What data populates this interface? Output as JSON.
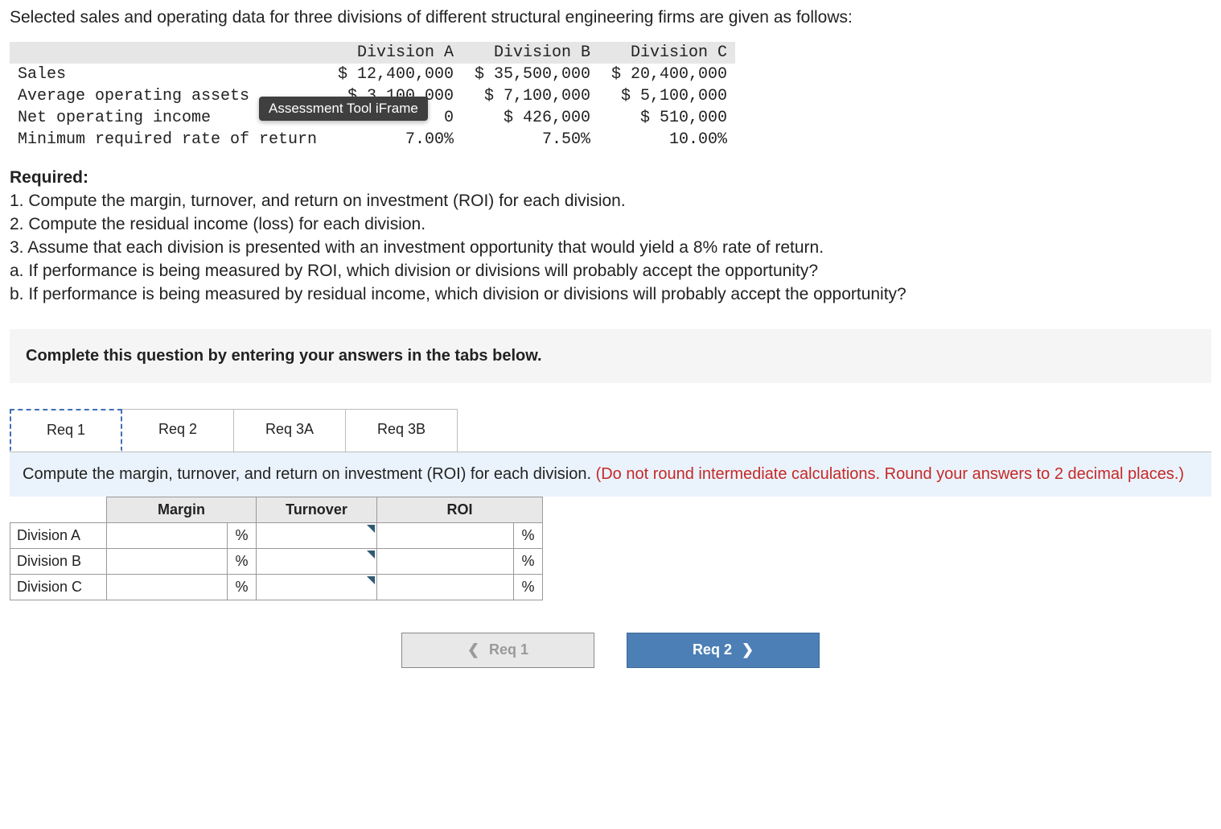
{
  "intro": "Selected sales and operating data for three divisions of different structural engineering firms are given as follows:",
  "data_table": {
    "col_headers": [
      "Division A",
      "Division B",
      "Division C"
    ],
    "rows": [
      {
        "label": "Sales",
        "vals": [
          "$ 12,400,000",
          "$ 35,500,000",
          "$ 20,400,000"
        ]
      },
      {
        "label": "Average operating assets",
        "vals": [
          "$ 3,100,000",
          "$ 7,100,000",
          "$ 5,100,000"
        ]
      },
      {
        "label": "Net operating income",
        "vals": [
          "0",
          "$ 426,000",
          "$ 510,000"
        ]
      },
      {
        "label": "Minimum required rate of return",
        "vals": [
          "7.00%",
          "7.50%",
          "10.00%"
        ]
      }
    ],
    "tooltip": "Assessment Tool iFrame"
  },
  "required": {
    "header": "Required:",
    "lines": [
      "1. Compute the margin, turnover, and return on investment (ROI) for each division.",
      "2. Compute the residual income (loss) for each division.",
      "3. Assume that each division is presented with an investment opportunity that would yield a 8% rate of return.",
      "a. If performance is being measured by ROI, which division or divisions will probably accept the opportunity?",
      "b. If performance is being measured by residual income, which division or divisions will probably accept the opportunity?"
    ]
  },
  "instruction_band": "Complete this question by entering your answers in the tabs below.",
  "tabs": [
    {
      "label": "Req 1",
      "active": true
    },
    {
      "label": "Req 2",
      "active": false
    },
    {
      "label": "Req 3A",
      "active": false
    },
    {
      "label": "Req 3B",
      "active": false
    }
  ],
  "tab_instruction": {
    "main": "Compute the margin, turnover, and return on investment (ROI) for each division. ",
    "hint": "(Do not round intermediate calculations. Round your answers to 2 decimal places.)"
  },
  "answer_table": {
    "headers": [
      "Margin",
      "Turnover",
      "ROI"
    ],
    "rows": [
      "Division A",
      "Division B",
      "Division C"
    ],
    "pct": "%"
  },
  "nav": {
    "prev": "Req 1",
    "next": "Req 2"
  }
}
